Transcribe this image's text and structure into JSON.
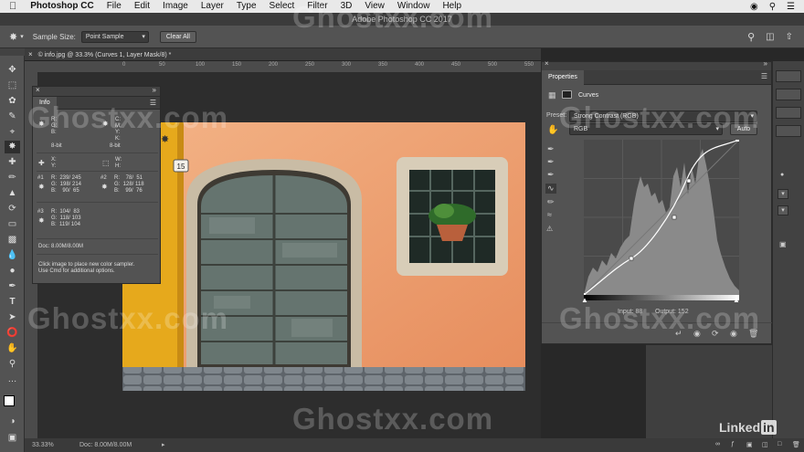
{
  "menubar": {
    "apple": "",
    "app": "Photoshop CC",
    "items": [
      "File",
      "Edit",
      "Image",
      "Layer",
      "Type",
      "Select",
      "Filter",
      "3D",
      "View",
      "Window",
      "Help"
    ]
  },
  "titlebar": {
    "title": "Adobe Photoshop CC 2017"
  },
  "options": {
    "sample_size_label": "Sample Size:",
    "sample_size_value": "Point Sample",
    "clear_all_label": "Clear All"
  },
  "document": {
    "tab_title": "info.jpg @ 33.3% (Curves 1, Layer Mask/8) *",
    "house_number": "15",
    "ruler_marks": [
      "0",
      "50",
      "100",
      "150",
      "200",
      "250",
      "300",
      "350",
      "400",
      "450",
      "500",
      "550"
    ]
  },
  "info_panel": {
    "tab": "Info",
    "rgb_labels": "R:\nG:\nB:",
    "cmyk_labels": "C:\nM:\nY:\nK:",
    "bit_left": "8-bit",
    "bit_right": "8-bit",
    "xy_labels": "X:\nY:",
    "wh_labels": "W:\nH:",
    "s1_label": "#1",
    "s1_values": "R:  239/ 245\nG:  198/ 214\nB:    90/  65",
    "s2_label": "#2",
    "s2_values": "R:    78/  51\nG:  128/ 118\nB:    99/  76",
    "s3_label": "#3",
    "s3_values": "R:  104/  83\nG:  118/ 103\nB:  119/ 104",
    "doc": "Doc: 8.00M/8.00M",
    "hint": "Click image to place new color sampler.\nUse Cmd for additional options."
  },
  "properties_panel": {
    "tab": "Properties",
    "layer_type": "Curves",
    "preset_label": "Preset:",
    "preset_value": "Strong Contrast (RGB)",
    "channel_value": "RGB",
    "auto_label": "Auto",
    "input_label": "Input: 88",
    "output_label": "Output: 152"
  },
  "status": {
    "zoom": "33.33%",
    "doc": "Doc: 8.00M/8.00M"
  },
  "watermark": {
    "text": "Ghostxx.com",
    "brand": "Linked"
  },
  "colors": {
    "accent": "#f1a97a",
    "wall": "#e8905e",
    "yellow": "#e6a91c",
    "ui_panel": "#535353"
  }
}
